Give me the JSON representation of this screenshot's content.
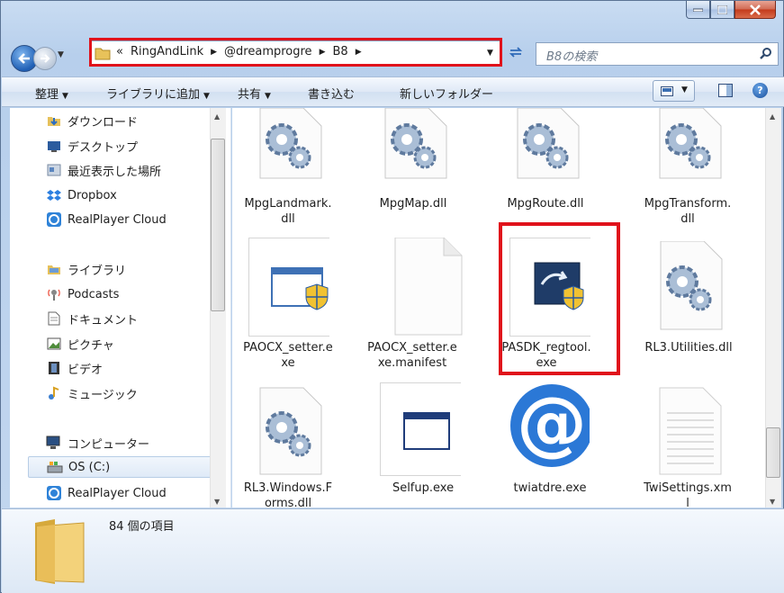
{
  "address": {
    "overflow_glyph": "«",
    "crumbs": [
      "RingAndLink",
      "@dreamprogre",
      "B8"
    ],
    "separator": "▶"
  },
  "search": {
    "placeholder": "B8の検索"
  },
  "toolbar": {
    "organize": "整理",
    "add_to_library": "ライブラリに追加",
    "share": "共有",
    "burn": "書き込む",
    "new_folder": "新しいフォルダー",
    "help": "?"
  },
  "nav": {
    "items": [
      {
        "label": "ダウンロード",
        "icon": "download-folder-icon"
      },
      {
        "label": "デスクトップ",
        "icon": "desktop-icon"
      },
      {
        "label": "最近表示した場所",
        "icon": "recent-places-icon"
      },
      {
        "label": "Dropbox",
        "icon": "dropbox-icon"
      },
      {
        "label": "RealPlayer Cloud",
        "icon": "realplayer-icon"
      },
      {
        "label": "ライブラリ",
        "icon": "library-icon"
      },
      {
        "label": "Podcasts",
        "icon": "podcast-icon"
      },
      {
        "label": "ドキュメント",
        "icon": "documents-icon"
      },
      {
        "label": "ピクチャ",
        "icon": "pictures-icon"
      },
      {
        "label": "ビデオ",
        "icon": "video-icon"
      },
      {
        "label": "ミュージック",
        "icon": "music-icon"
      },
      {
        "label": "コンピューター",
        "icon": "computer-icon"
      },
      {
        "label": "OS (C:)",
        "icon": "drive-icon"
      },
      {
        "label": "RealPlayer Cloud",
        "icon": "realplayer-icon"
      }
    ]
  },
  "files": [
    {
      "line1": "MpgLandmark.",
      "line2": "dll",
      "icon": "gear-file-icon"
    },
    {
      "line1": "MpgMap.dll",
      "line2": "",
      "icon": "gear-file-icon"
    },
    {
      "line1": "MpgRoute.dll",
      "line2": "",
      "icon": "gear-file-icon"
    },
    {
      "line1": "MpgTransform.",
      "line2": "dll",
      "icon": "gear-file-icon"
    },
    {
      "line1": "PAOCX_setter.e",
      "line2": "xe",
      "icon": "exe-shield-icon"
    },
    {
      "line1": "PAOCX_setter.e",
      "line2": "xe.manifest",
      "icon": "blank-file-icon"
    },
    {
      "line1": "PASDK_regtool.",
      "line2": "exe",
      "icon": "regtool-shield-icon"
    },
    {
      "line1": "RL3.Utilities.dll",
      "line2": "",
      "icon": "gear-file-icon"
    },
    {
      "line1": "RL3.Windows.F",
      "line2": "orms.dll",
      "icon": "gear-file-icon"
    },
    {
      "line1": "Selfup.exe",
      "line2": "",
      "icon": "window-app-icon"
    },
    {
      "line1": "twiatdre.exe",
      "line2": "",
      "icon": "at-sign-icon"
    },
    {
      "line1": "TwiSettings.xm",
      "line2": "l",
      "icon": "text-file-icon"
    }
  ],
  "status": {
    "item_count": "84 個の項目"
  }
}
